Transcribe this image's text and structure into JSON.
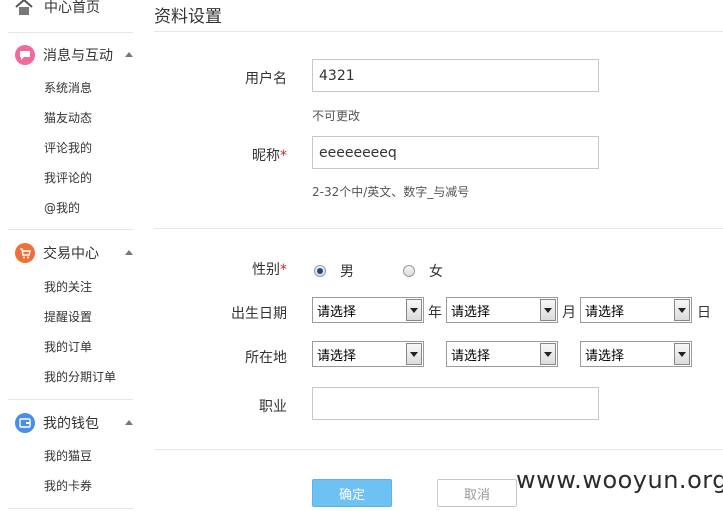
{
  "sidebar": {
    "home_label": "中心首页",
    "sections": [
      {
        "label": "消息与互动",
        "items": [
          "系统消息",
          "猫友动态",
          "评论我的",
          "我评论的",
          "@我的"
        ]
      },
      {
        "label": "交易中心",
        "items": [
          "我的关注",
          "提醒设置",
          "我的订单",
          "我的分期订单"
        ]
      },
      {
        "label": "我的钱包",
        "items": [
          "我的猫豆",
          "我的卡券"
        ]
      }
    ],
    "colors": {
      "messages": "#f06aa0",
      "trade": "#f0703c",
      "wallet": "#4a8ee6"
    }
  },
  "page": {
    "title": "资料设置",
    "username_label": "用户名",
    "username_value": "4321",
    "username_hint": "不可更改",
    "nickname_label": "昵称",
    "required_mark": "*",
    "nickname_value": "eeeeeeeeq",
    "nickname_hint": "2-32个中/英文、数字_与减号",
    "gender_label": "性别",
    "gender_options": [
      "男",
      "女"
    ],
    "gender_selected": "男",
    "birthday_label": "出生日期",
    "birthday_year": "请选择",
    "birthday_month": "请选择",
    "birthday_day": "请选择",
    "unit_year": "年",
    "unit_month": "月",
    "unit_day": "日",
    "location_label": "所在地",
    "location_province": "请选择",
    "location_city": "请选择",
    "location_district": "请选择",
    "job_label": "职业",
    "job_value": "",
    "confirm_label": "确定",
    "cancel_label": "取消"
  },
  "watermark": "www.wooyun.org"
}
